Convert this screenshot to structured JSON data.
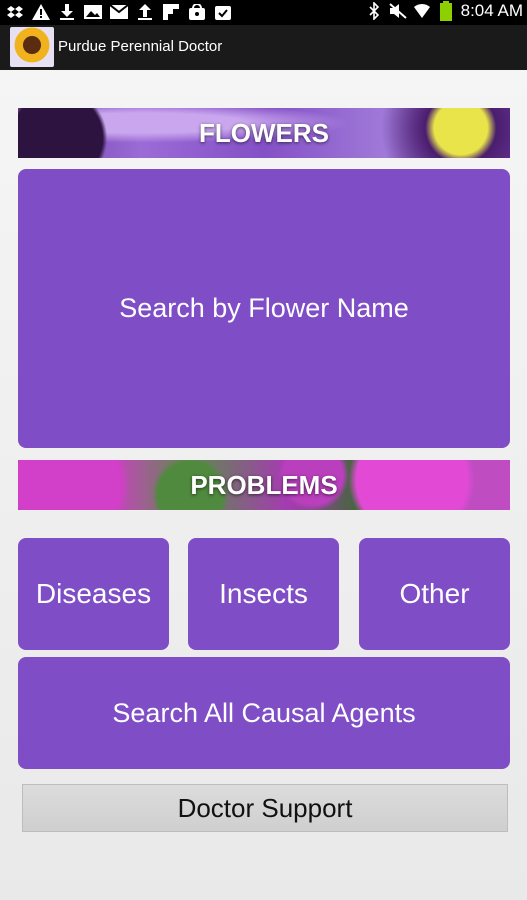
{
  "status_bar": {
    "time": "8:04 AM",
    "left_icons": [
      "dropbox-icon",
      "warning-icon",
      "download-icon",
      "image-icon",
      "mail-icon",
      "upload-icon",
      "flipboard-icon",
      "bag-icon",
      "clipboard-check-icon"
    ],
    "right_icons": [
      "bluetooth-icon",
      "mute-icon",
      "wifi-icon",
      "battery-icon"
    ],
    "battery_color": "#8cd000"
  },
  "action_bar": {
    "title": "Purdue Perennial Doctor"
  },
  "flowers_section": {
    "header": "FLOWERS",
    "search_button": "Search by Flower Name"
  },
  "problems_section": {
    "header": "PROBLEMS",
    "diseases_button": "Diseases",
    "insects_button": "Insects",
    "other_button": "Other",
    "causal_button": "Search All Causal Agents"
  },
  "support": {
    "button": "Doctor Support"
  },
  "colors": {
    "accent": "#7f4ec7",
    "statusbar": "#000000",
    "actionbar": "#1a1a1a"
  }
}
